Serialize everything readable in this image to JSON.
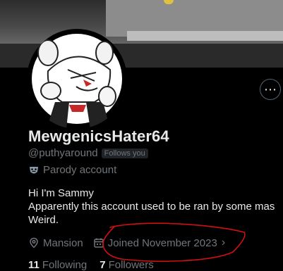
{
  "profile": {
    "display_name": "MewgenicsHater64",
    "handle": "@puthyaround",
    "follows_you_badge": "Follows you",
    "label": "Parody account",
    "bio_lines": [
      "Hi I'm Sammy",
      "Apparently this account used to be ran by some mas",
      "Weird."
    ],
    "location": "Mansion",
    "joined": "Joined November 2023"
  },
  "stats": {
    "following_count": "11",
    "following_label": "Following",
    "followers_count": "7",
    "followers_label": "Followers"
  },
  "icons": {
    "more": "more-options-icon",
    "parody": "parody-mask-icon",
    "location": "location-pin-icon",
    "calendar": "calendar-icon",
    "chevron": "chevron-right-icon"
  },
  "colors": {
    "background": "#000000",
    "primary_text": "#e7e9ea",
    "secondary_text": "#71767b",
    "annotation": "#d01010"
  }
}
